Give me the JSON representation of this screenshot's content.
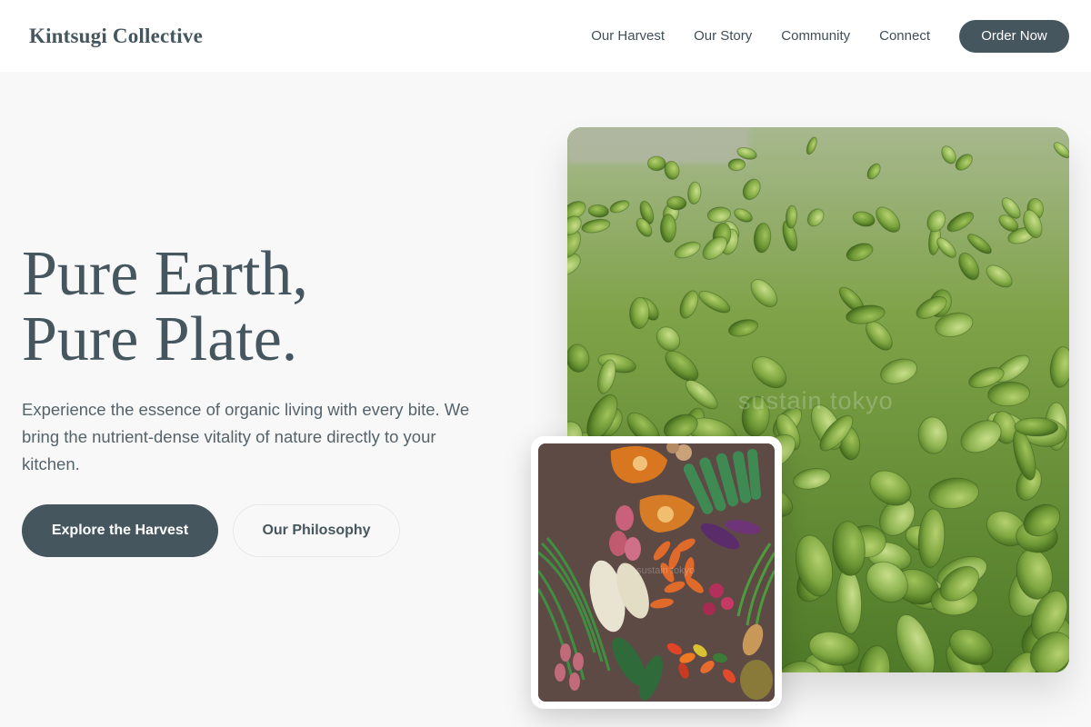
{
  "header": {
    "brand": "Kintsugi Collective",
    "nav": [
      "Our Harvest",
      "Our Story",
      "Community",
      "Connect"
    ],
    "cta": "Order Now"
  },
  "hero": {
    "title_line1": "Pure Earth,",
    "title_line2": "Pure Plate.",
    "description": "Experience the essence of organic living with every bite. We bring the nutrient-dense vitality of nature directly to your kitchen.",
    "primary_button": "Explore the Harvest",
    "secondary_button": "Our Philosophy"
  },
  "images": {
    "main_watermark": "sustain tokyo",
    "inset_watermark": "sustain tokyo"
  },
  "colors": {
    "accent": "#45565f",
    "background": "#f8f8f8",
    "header_bg": "#ffffff",
    "sprout_green": "#6f9a3e"
  }
}
